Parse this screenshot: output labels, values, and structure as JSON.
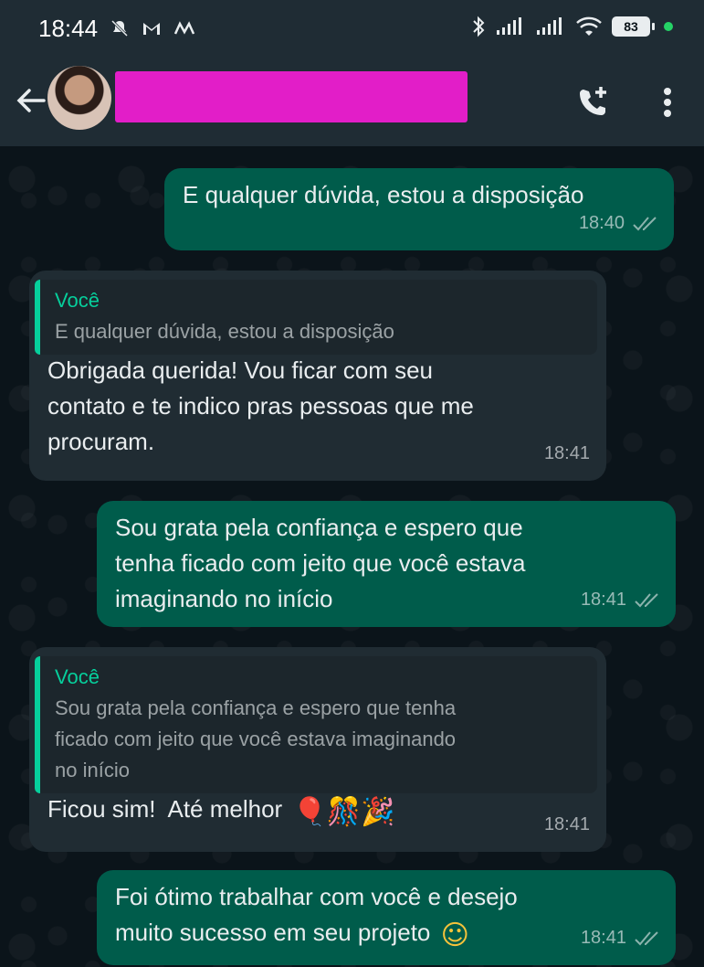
{
  "status_bar": {
    "time": "18:44",
    "battery": "83",
    "icons": [
      "mute-icon",
      "gmail-icon",
      "m-app-icon",
      "bluetooth-icon",
      "signal-icon",
      "signal-icon",
      "wifi-icon",
      "battery-icon"
    ]
  },
  "header": {
    "contact_name": "",
    "icons": [
      "back-arrow-icon",
      "add-call-icon",
      "more-vert-icon"
    ]
  },
  "messages": [
    {
      "direction": "out",
      "text": "E qualquer dúvida, estou a disposição",
      "time": "18:40"
    },
    {
      "direction": "in",
      "quote_author": "Você",
      "quote_text": "E qualquer dúvida, estou a disposição",
      "text": "Obrigada querida! Vou ficar com seu\ncontato e te indico pras pessoas que me\nprocuram.",
      "time": "18:41"
    },
    {
      "direction": "out",
      "text": "Sou grata pela confiança e espero que\ntenha ficado com jeito que você estava\nimaginando no início",
      "time": "18:41"
    },
    {
      "direction": "in",
      "quote_author": "Você",
      "quote_text": "Sou grata pela confiança e espero que tenha\nficado com jeito que você estava imaginando\nno início",
      "text": "Ficou sim!  Até melhor",
      "emojis": "🎈🎊🎉",
      "time": "18:41"
    },
    {
      "direction": "out",
      "text": "Foi ótimo trabalhar com você e desejo\nmuito sucesso em seu projeto",
      "emoji": "☺",
      "time": "18:41"
    }
  ],
  "colors": {
    "outgoing_bubble": "#005c4b",
    "incoming_bubble": "#202c33",
    "quote_accent": "#06cf9c",
    "redaction": "#e21ec8"
  }
}
